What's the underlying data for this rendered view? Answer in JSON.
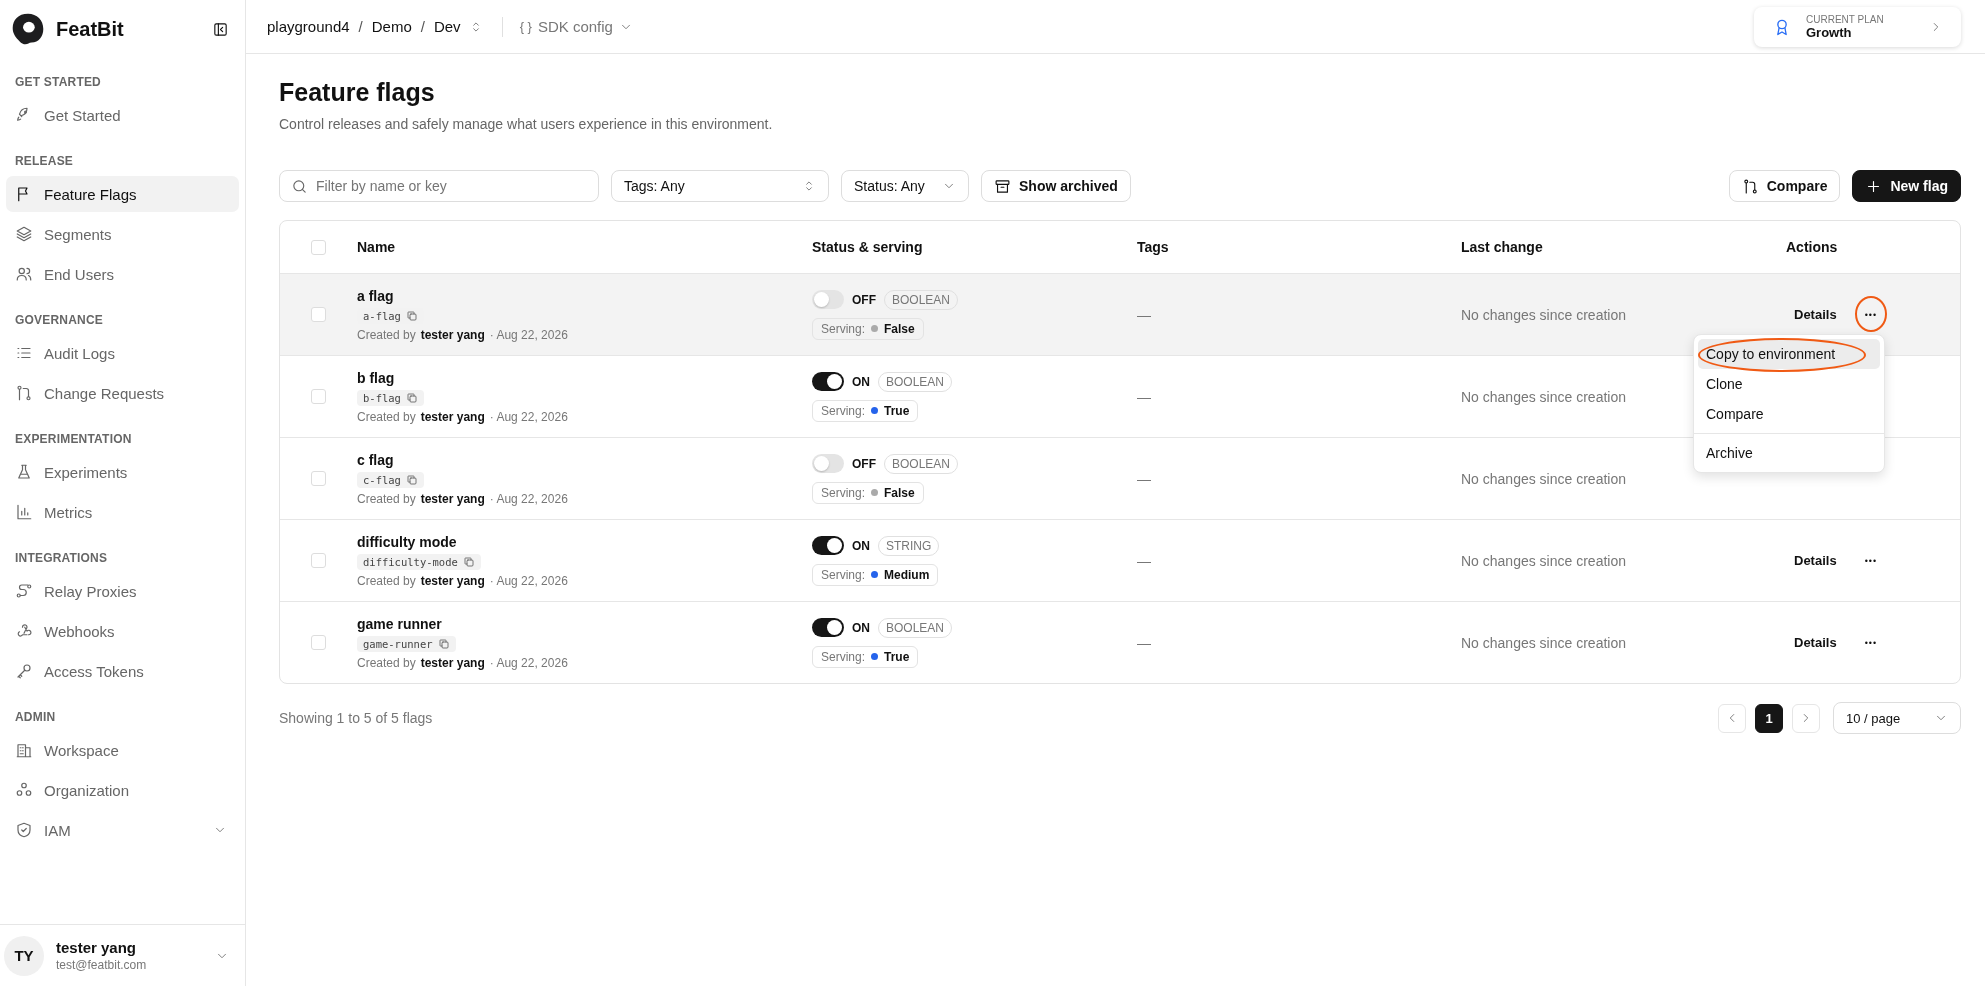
{
  "brand": {
    "name": "FeatBit"
  },
  "sidebar": {
    "sections": [
      {
        "title": "GET STARTED",
        "items": [
          {
            "label": "Get Started",
            "selected": false,
            "expandable": false
          }
        ]
      },
      {
        "title": "RELEASE",
        "items": [
          {
            "label": "Feature Flags",
            "selected": true,
            "expandable": false
          },
          {
            "label": "Segments",
            "selected": false,
            "expandable": false
          },
          {
            "label": "End Users",
            "selected": false,
            "expandable": false
          }
        ]
      },
      {
        "title": "GOVERNANCE",
        "items": [
          {
            "label": "Audit Logs",
            "selected": false,
            "expandable": false
          },
          {
            "label": "Change Requests",
            "selected": false,
            "expandable": false
          }
        ]
      },
      {
        "title": "EXPERIMENTATION",
        "items": [
          {
            "label": "Experiments",
            "selected": false,
            "expandable": false
          },
          {
            "label": "Metrics",
            "selected": false,
            "expandable": false
          }
        ]
      },
      {
        "title": "INTEGRATIONS",
        "items": [
          {
            "label": "Relay Proxies",
            "selected": false,
            "expandable": false
          },
          {
            "label": "Webhooks",
            "selected": false,
            "expandable": false
          },
          {
            "label": "Access Tokens",
            "selected": false,
            "expandable": false
          }
        ]
      },
      {
        "title": "ADMIN",
        "items": [
          {
            "label": "Workspace",
            "selected": false,
            "expandable": false
          },
          {
            "label": "Organization",
            "selected": false,
            "expandable": false
          },
          {
            "label": "IAM",
            "selected": false,
            "expandable": true
          }
        ]
      }
    ],
    "user": {
      "initials": "TY",
      "name": "tester yang",
      "email": "test@featbit.com"
    }
  },
  "breadcrumb": [
    {
      "label": "playground4",
      "separator": "/"
    },
    {
      "label": "Demo",
      "separator": "/"
    },
    {
      "label": "Dev"
    }
  ],
  "sdk_config": {
    "icon_text": "{ }",
    "label": "SDK config"
  },
  "plan": {
    "caption": "CURRENT PLAN",
    "name": "Growth"
  },
  "page": {
    "title": "Feature flags",
    "subtitle": "Control releases and safely manage what users experience in this environment."
  },
  "toolbar": {
    "search_placeholder": "Filter by name or key",
    "tags_filter": "Tags: Any",
    "status_filter": "Status: Any",
    "archived_button": "Show archived",
    "compare_button": "Compare",
    "new_button": "New flag"
  },
  "table": {
    "select_all_checked": false,
    "columns": [
      "Name",
      "Status & serving",
      "Tags",
      "Last change",
      "Actions"
    ],
    "rows": [
      {
        "checked": false,
        "name": "a flag",
        "key": "a-flag",
        "created_prefix": "Created by",
        "creator": "tester yang",
        "date": "· Aug 22, 2026",
        "on": false,
        "status": "OFF",
        "type": "BOOLEAN",
        "serving_label": "Serving:",
        "serving": "False",
        "tags": "—",
        "last_change": "No changes since creation",
        "details": "Details",
        "more": "•••",
        "hovered": true,
        "circled": true
      },
      {
        "checked": false,
        "name": "b flag",
        "key": "b-flag",
        "created_prefix": "Created by",
        "creator": "tester yang",
        "date": "· Aug 22, 2026",
        "on": true,
        "status": "ON",
        "type": "BOOLEAN",
        "serving_label": "Serving:",
        "serving": "True",
        "tags": "—",
        "last_change": "No changes since creation",
        "hovered": false,
        "circled": false
      },
      {
        "checked": false,
        "name": "c flag",
        "key": "c-flag",
        "created_prefix": "Created by",
        "creator": "tester yang",
        "date": "· Aug 22, 2026",
        "on": false,
        "status": "OFF",
        "type": "BOOLEAN",
        "serving_label": "Serving:",
        "serving": "False",
        "tags": "—",
        "last_change": "No changes since creation",
        "hovered": false,
        "circled": false
      },
      {
        "checked": false,
        "name": "difficulty mode",
        "key": "difficulty-mode",
        "created_prefix": "Created by",
        "creator": "tester yang",
        "date": "· Aug 22, 2026",
        "on": true,
        "status": "ON",
        "type": "STRING",
        "serving_label": "Serving:",
        "serving": "Medium",
        "tags": "—",
        "last_change": "No changes since creation",
        "details": "Details",
        "more": "•••",
        "hovered": false,
        "circled": false
      },
      {
        "checked": false,
        "name": "game runner",
        "key": "game-runner",
        "created_prefix": "Created by",
        "creator": "tester yang",
        "date": "· Aug 22, 2026",
        "on": true,
        "status": "ON",
        "type": "BOOLEAN",
        "serving_label": "Serving:",
        "serving": "True",
        "tags": "—",
        "last_change": "No changes since creation",
        "details": "Details",
        "more": "•••",
        "hovered": false,
        "circled": false
      }
    ]
  },
  "menu": {
    "items": [
      {
        "label": "Copy to environment",
        "selected": true,
        "circled": true,
        "divider_before": false
      },
      {
        "label": "Clone",
        "selected": false,
        "circled": false,
        "divider_before": false
      },
      {
        "label": "Compare",
        "selected": false,
        "circled": false,
        "divider_before": false
      },
      {
        "label": "Archive",
        "selected": false,
        "circled": false,
        "divider_before": true
      }
    ]
  },
  "footer": {
    "summary": "Showing 1 to 5 of 5 flags",
    "pages": [
      {
        "label": "1",
        "selected": true
      }
    ],
    "page_size": "10 / page"
  }
}
